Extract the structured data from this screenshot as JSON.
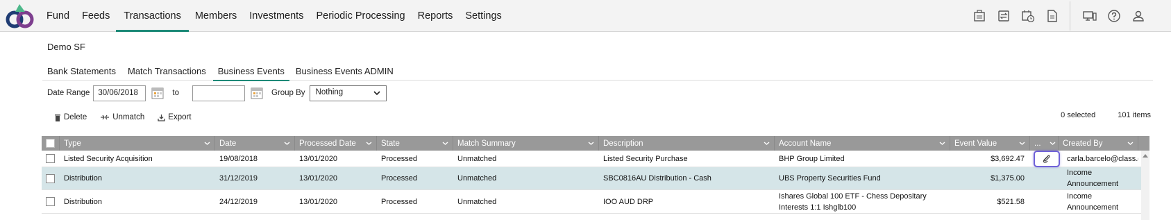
{
  "nav": {
    "items": [
      "Fund",
      "Feeds",
      "Transactions",
      "Members",
      "Investments",
      "Periodic Processing",
      "Reports",
      "Settings"
    ],
    "active": "Transactions"
  },
  "top_icons": [
    "calendar-grid-icon",
    "exchange-icon",
    "calendar-clock-icon",
    "report-icon",
    "monitor-icon",
    "help-icon",
    "user-icon"
  ],
  "fund_name": "Demo SF",
  "subtabs": [
    "Bank Statements",
    "Match Transactions",
    "Business Events",
    "Business Events ADMIN"
  ],
  "active_subtab": "Business Events",
  "filters": {
    "date_range_label": "Date Range",
    "date_from": "30/06/2018",
    "to_label": "to",
    "date_to": "",
    "group_by_label": "Group By",
    "group_by_value": "Nothing"
  },
  "toolbar": {
    "delete_label": "Delete",
    "unmatch_label": "Unmatch",
    "export_label": "Export"
  },
  "counts": {
    "selected": "0 selected",
    "items": "101 items"
  },
  "grid": {
    "headers": [
      "Type",
      "Date",
      "Processed Date",
      "State",
      "Match Summary",
      "Description",
      "Account Name",
      "Event Value",
      "...",
      "Created By"
    ],
    "rows": [
      {
        "type": "Listed Security Acquisition",
        "date": "19/08/2018",
        "processed": "13/01/2020",
        "state": "Processed",
        "match": "Unmatched",
        "description": "Listed Security Purchase",
        "account": "BHP Group Limited",
        "value": "$3,692.47",
        "created_by": "carla.barcelo@class.com.au"
      },
      {
        "type": "Distribution",
        "date": "31/12/2019",
        "processed": "13/01/2020",
        "state": "Processed",
        "match": "Unmatched",
        "description": "SBC0816AU Distribution - Cash",
        "account": "UBS Property Securities Fund",
        "value": "$1,375.00",
        "created_by": "Income Announcement"
      },
      {
        "type": "Distribution",
        "date": "24/12/2019",
        "processed": "13/01/2020",
        "state": "Processed",
        "match": "Unmatched",
        "description": "IOO AUD DRP",
        "account": "Ishares Global 100 ETF - Chess Depositary Interests 1:1 Ishglb100",
        "value": "$521.58",
        "created_by": "Income Announcement"
      }
    ]
  },
  "colors": {
    "accent": "#1e8a78",
    "header_bg": "#999999",
    "selected_row": "#d5e5e8",
    "focus": "#7062d8"
  }
}
